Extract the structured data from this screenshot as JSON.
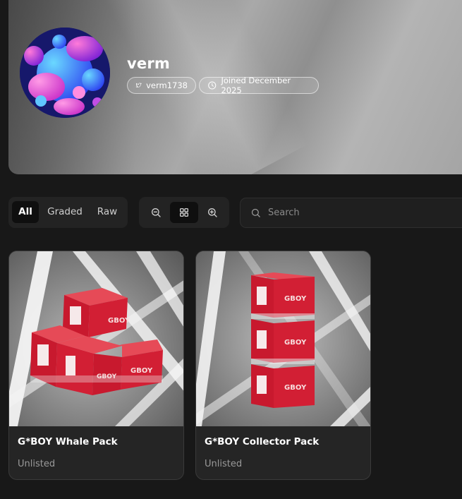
{
  "profile": {
    "username": "verm",
    "twitter_handle": "verm1738",
    "joined": "Joined December 2025"
  },
  "filters": {
    "tabs": [
      {
        "label": "All",
        "active": true
      },
      {
        "label": "Graded",
        "active": false
      },
      {
        "label": "Raw",
        "active": false
      }
    ]
  },
  "view_controls": {
    "zoom_out_icon": "zoom-out-icon",
    "grid_icon": "grid-icon",
    "zoom_in_icon": "zoom-in-icon",
    "active": "grid"
  },
  "search": {
    "placeholder": "Search",
    "value": ""
  },
  "items": [
    {
      "title": "G*BOY Whale Pack",
      "status": "Unlisted",
      "image": "stacked-pack-boxes-pyramid"
    },
    {
      "title": "G*BOY Collector Pack",
      "status": "Unlisted",
      "image": "stacked-pack-boxes-column"
    }
  ],
  "colors": {
    "background": "#181818",
    "card": "#252525",
    "box_red": "#c8192e"
  }
}
